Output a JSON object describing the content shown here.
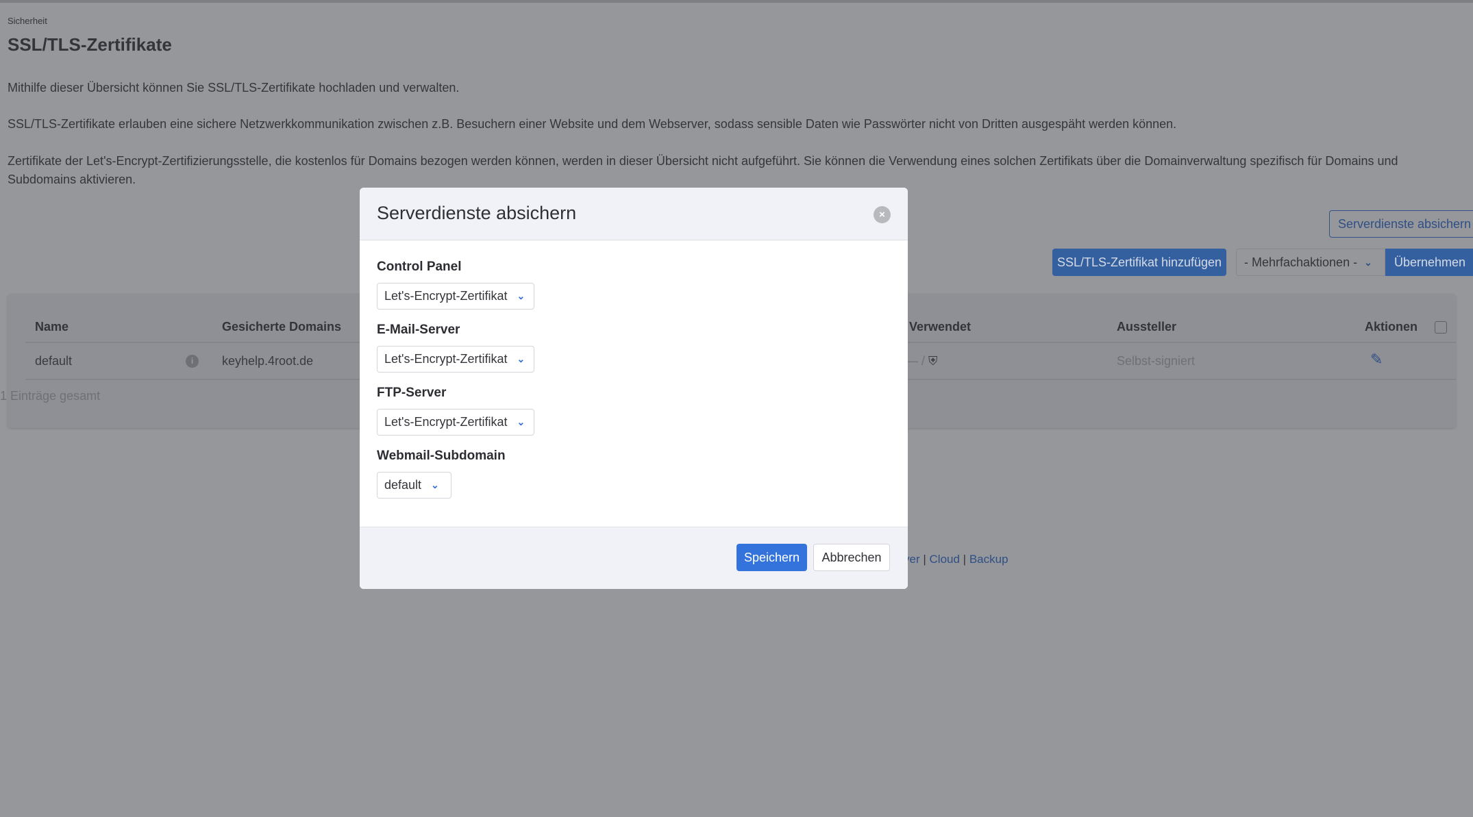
{
  "breadcrumb": "Sicherheit",
  "page_title": "SSL/TLS-Zertifikate",
  "paragraphs": [
    "Mithilfe dieser Übersicht können Sie SSL/TLS-Zertifikate hochladen und verwalten.",
    "SSL/TLS-Zertifikate erlauben eine sichere Netzwerkkommunikation zwischen z.B. Besuchern einer Website und dem Webserver, sodass sensible Daten wie Passwörter nicht von Dritten ausgespäht werden können.",
    "Zertifikate der Let's-Encrypt-Zertifizierungsstelle, die kostenlos für Domains bezogen werden können, werden in dieser Übersicht nicht aufgeführt. Sie können die Verwendung eines solchen Zertifikats über die Domainverwaltung spezifisch für Domains und Subdomains aktivieren."
  ],
  "toolbar": {
    "secure_services": "Serverdienste absichern",
    "add_cert": "SSL/TLS-Zertifikat hinzufügen",
    "bulk_actions": "- Mehrfachaktionen -",
    "apply": "Übernehmen"
  },
  "table": {
    "headers": {
      "name": "Name",
      "domains": "Gesicherte Domains",
      "used": "Verwendet",
      "issuer": "Aussteller",
      "actions": "Aktionen"
    },
    "rows": [
      {
        "name": "default",
        "domains": "keyhelp.4root.de",
        "used": "— /",
        "issuer": "Selbst-signiert"
      }
    ],
    "total": "1 Einträge gesamt"
  },
  "footer": {
    "partial": "ver",
    "links": [
      "Cloud",
      "Backup"
    ],
    "separator": "|"
  },
  "modal": {
    "title": "Serverdienste absichern",
    "fields": [
      {
        "label": "Control Panel",
        "value": "Let's-Encrypt-Zertifikat"
      },
      {
        "label": "E-Mail-Server",
        "value": "Let's-Encrypt-Zertifikat"
      },
      {
        "label": "FTP-Server",
        "value": "Let's-Encrypt-Zertifikat"
      },
      {
        "label": "Webmail-Subdomain",
        "value": "default"
      }
    ],
    "save": "Speichern",
    "cancel": "Abbrechen"
  },
  "colors": {
    "primary": "#3373db",
    "overlay": "#96979b"
  }
}
